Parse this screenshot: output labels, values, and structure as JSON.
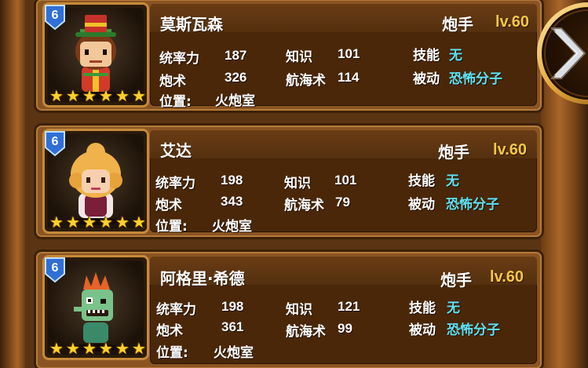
{
  "colors": {
    "accent_level": "#f6c74a",
    "skill_text": "#5fe0f0",
    "card_bg": "#4a2709",
    "card_border": "#b57a3a",
    "star": "#ffd12a",
    "badge_blue": "#2f6fd6"
  },
  "labels": {
    "command": "统率力",
    "knowledge": "知识",
    "skill": "技能",
    "gunnery": "炮术",
    "navigation": "航海术",
    "passive": "被动",
    "position": "位置:"
  },
  "next_button": {
    "icon": "chevron-right-icon"
  },
  "officers": [
    {
      "name": "莫斯瓦森",
      "grade": "6",
      "stars": 6,
      "role": "炮手",
      "level": "lv.60",
      "command": "187",
      "knowledge": "101",
      "skill": "无",
      "gunnery": "326",
      "navigation": "114",
      "passive": "恐怖分子",
      "position": "火炮室",
      "portrait_icon": "captain-tophat-portrait-icon"
    },
    {
      "name": "艾达",
      "grade": "6",
      "stars": 6,
      "role": "炮手",
      "level": "lv.60",
      "command": "198",
      "knowledge": "101",
      "skill": "无",
      "gunnery": "343",
      "navigation": "79",
      "passive": "恐怖分子",
      "position": "火炮室",
      "portrait_icon": "blonde-lady-portrait-icon"
    },
    {
      "name": "阿格里·希德",
      "grade": "6",
      "stars": 6,
      "role": "炮手",
      "level": "lv.60",
      "command": "198",
      "knowledge": "121",
      "skill": "无",
      "gunnery": "361",
      "navigation": "99",
      "passive": "恐怖分子",
      "position": "火炮室",
      "portrait_icon": "green-zombie-portrait-icon"
    }
  ]
}
